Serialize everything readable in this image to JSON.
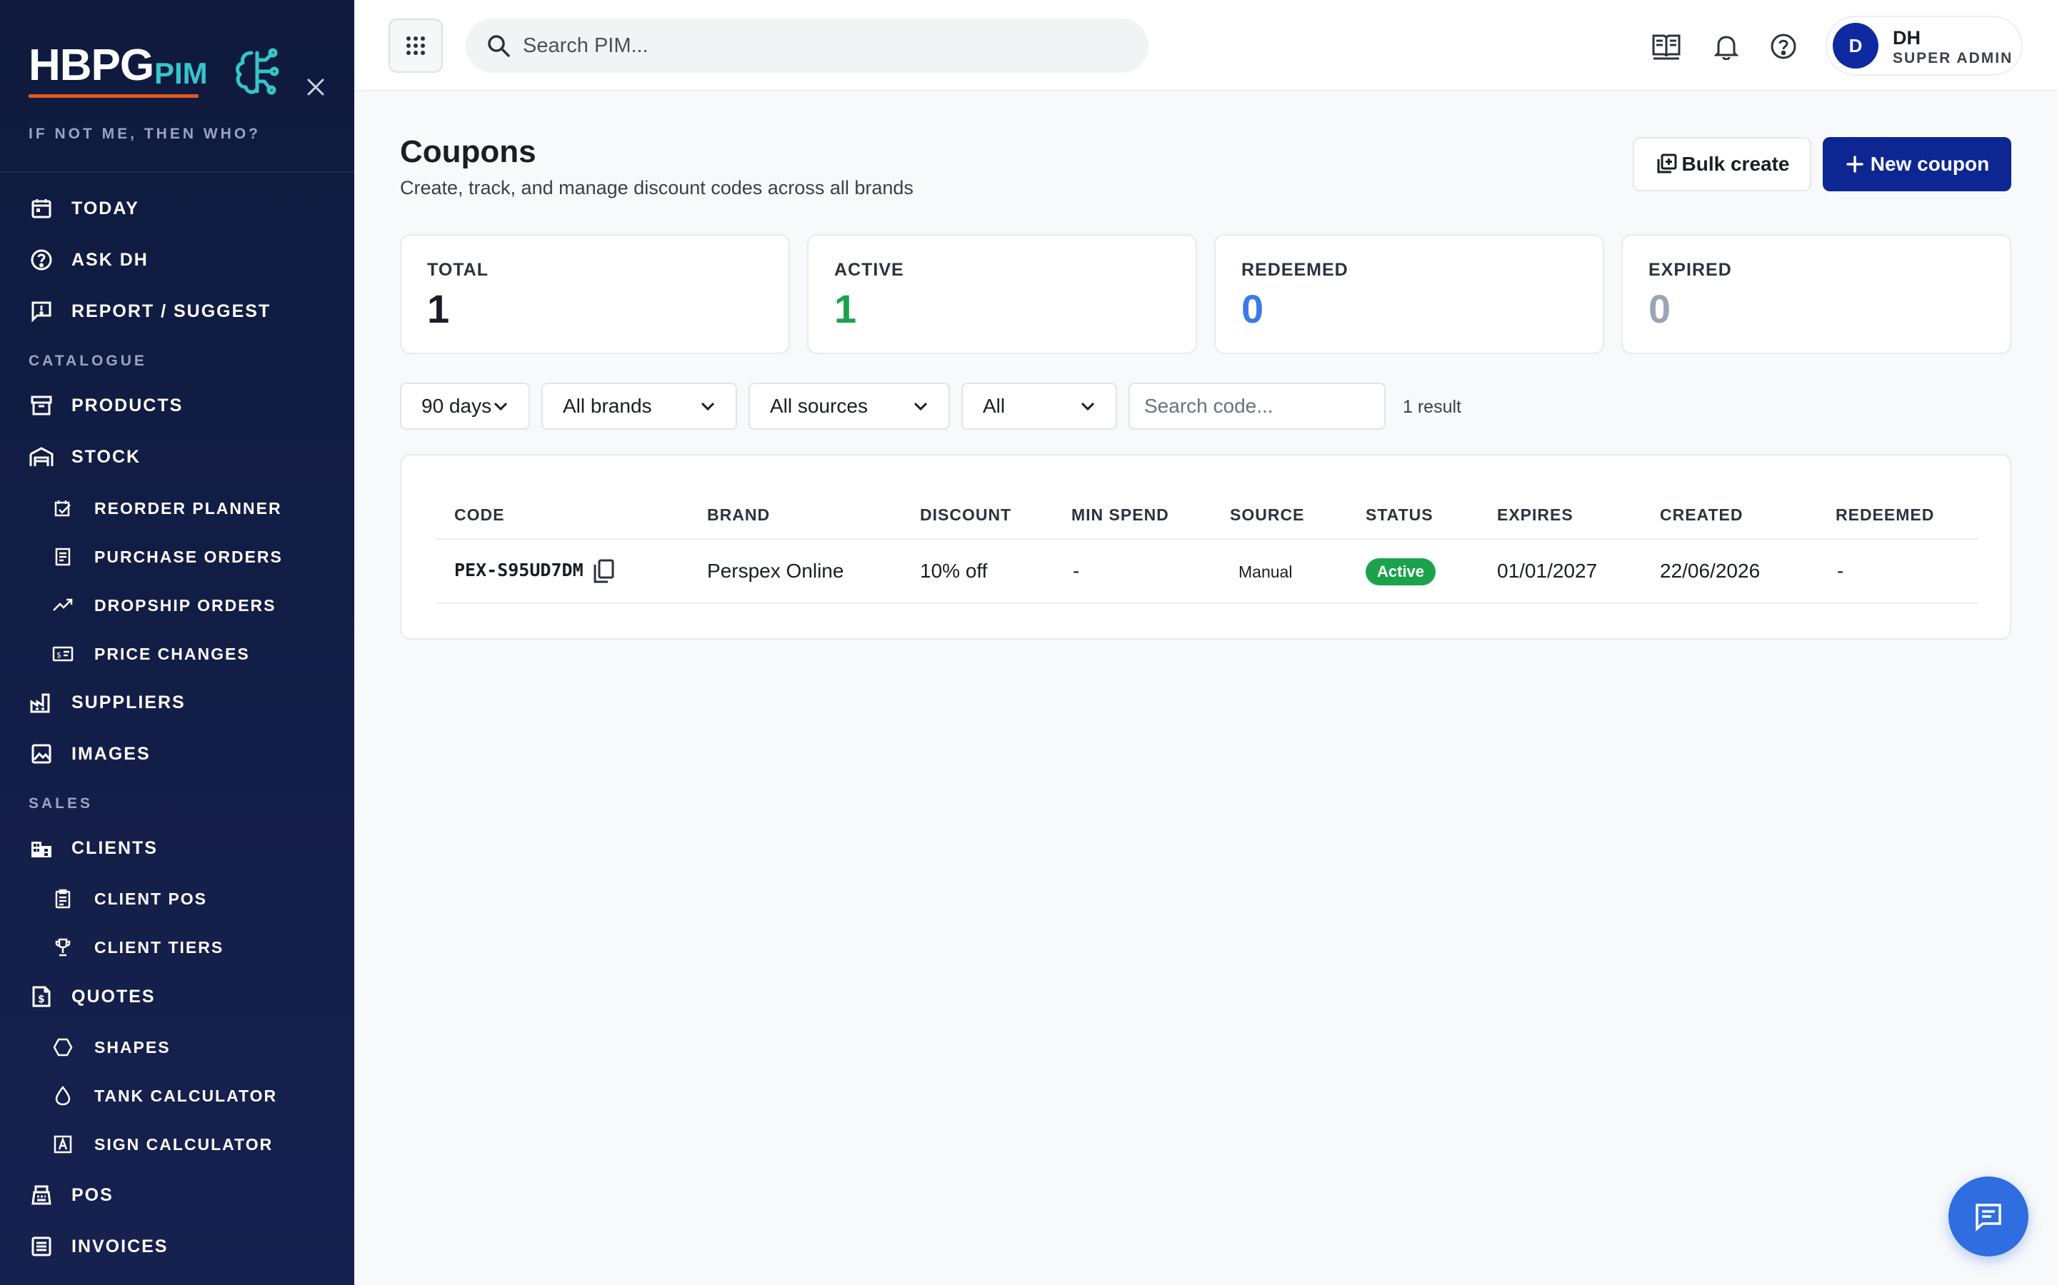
{
  "sidebar": {
    "brand_main": "HBPG",
    "brand_sub": "PIM",
    "tagline": "IF NOT ME, THEN WHO?",
    "items": [
      {
        "label": "TODAY",
        "icon": "calendar-icon"
      },
      {
        "label": "ASK DH",
        "icon": "help-circle-icon"
      },
      {
        "label": "REPORT / SUGGEST",
        "icon": "feedback-icon"
      },
      {
        "section": "CATALOGUE"
      },
      {
        "label": "PRODUCTS",
        "icon": "archive-icon"
      },
      {
        "label": "STOCK",
        "icon": "warehouse-icon"
      },
      {
        "label": "REORDER PLANNER",
        "icon": "reorder-icon",
        "sub": true
      },
      {
        "label": "PURCHASE ORDERS",
        "icon": "receipt-icon",
        "sub": true
      },
      {
        "label": "DROPSHIP ORDERS",
        "icon": "trending-icon",
        "sub": true
      },
      {
        "label": "PRICE CHANGES",
        "icon": "price-tag-icon",
        "sub": true
      },
      {
        "label": "SUPPLIERS",
        "icon": "factory-icon"
      },
      {
        "label": "IMAGES",
        "icon": "image-icon"
      },
      {
        "section": "SALES"
      },
      {
        "label": "CLIENTS",
        "icon": "building-icon"
      },
      {
        "label": "CLIENT POS",
        "icon": "clipboard-icon",
        "sub": true
      },
      {
        "label": "CLIENT TIERS",
        "icon": "trophy-icon",
        "sub": true
      },
      {
        "label": "QUOTES",
        "icon": "quote-doc-icon"
      },
      {
        "label": "SHAPES",
        "icon": "hexagon-icon",
        "sub": true
      },
      {
        "label": "TANK CALCULATOR",
        "icon": "drop-icon",
        "sub": true
      },
      {
        "label": "SIGN CALCULATOR",
        "icon": "sign-icon",
        "sub": true
      },
      {
        "label": "POS",
        "icon": "pos-icon"
      },
      {
        "label": "INVOICES",
        "icon": "invoice-icon"
      }
    ]
  },
  "topbar": {
    "search_placeholder": "Search PIM...",
    "user": {
      "initial": "D",
      "name": "DH",
      "role": "SUPER ADMIN"
    }
  },
  "page": {
    "title": "Coupons",
    "subtitle": "Create, track, and manage discount codes across all brands",
    "bulk_label": "Bulk create",
    "new_label": "New coupon"
  },
  "stats": [
    {
      "label": "TOTAL",
      "value": "1",
      "color": "#1a1d24"
    },
    {
      "label": "ACTIVE",
      "value": "1",
      "color": "#1ba34b"
    },
    {
      "label": "REDEEMED",
      "value": "0",
      "color": "#3b7be8"
    },
    {
      "label": "EXPIRED",
      "value": "0",
      "color": "#9aa5b8"
    }
  ],
  "filters": {
    "period": "90 days",
    "brand": "All brands",
    "source": "All sources",
    "status": "All",
    "search_placeholder": "Search code...",
    "result_count": "1 result"
  },
  "table": {
    "columns": [
      "CODE",
      "BRAND",
      "DISCOUNT",
      "MIN SPEND",
      "SOURCE",
      "STATUS",
      "EXPIRES",
      "CREATED",
      "REDEEMED"
    ],
    "rows": [
      {
        "code": "PEX-S95UD7DM",
        "brand": "Perspex Online",
        "discount": "10% off",
        "min_spend": "-",
        "source": "Manual",
        "status": "Active",
        "expires": "01/01/2027",
        "created": "22/06/2026",
        "redeemed": "-"
      }
    ]
  }
}
